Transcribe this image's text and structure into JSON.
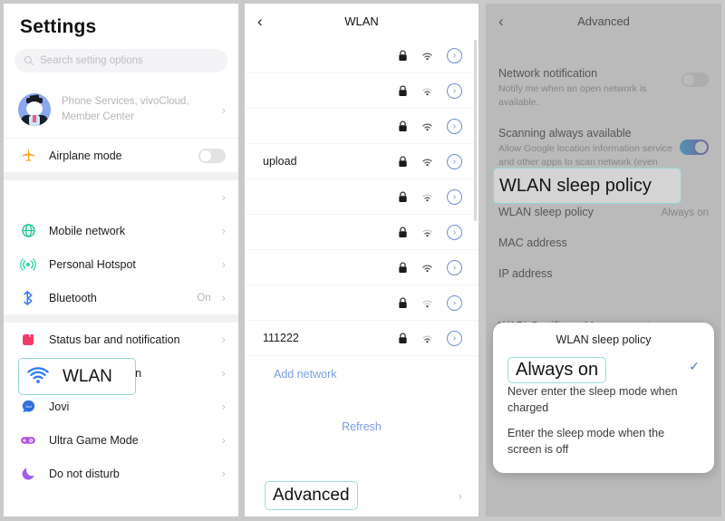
{
  "settings": {
    "title": "Settings",
    "search": {
      "placeholder": "Search setting options",
      "icon": "search-icon"
    },
    "account": {
      "text": "Phone Services, vivoCloud, Member Center",
      "icon": "avatar"
    },
    "groups": [
      {
        "items": [
          {
            "label": "Airplane mode",
            "icon": "airplane-icon",
            "control": "toggle-off",
            "value": ""
          }
        ]
      },
      {
        "items": [
          {
            "label": "WLAN",
            "icon": "wifi-icon",
            "control": "chevron",
            "value": "",
            "highlighted": true
          },
          {
            "label": "Mobile network",
            "icon": "globe-icon",
            "control": "chevron",
            "value": ""
          },
          {
            "label": "Personal Hotspot",
            "icon": "hotspot-icon",
            "control": "chevron",
            "value": ""
          },
          {
            "label": "Bluetooth",
            "icon": "bluetooth-icon",
            "control": "chevron",
            "value": "On"
          }
        ]
      },
      {
        "items": [
          {
            "label": "Status bar and notification",
            "icon": "status-bar-icon",
            "control": "chevron",
            "value": ""
          },
          {
            "label": "System navigation",
            "icon": "system-navigation-icon",
            "control": "chevron",
            "value": ""
          },
          {
            "label": "Jovi",
            "icon": "jovi-icon",
            "control": "chevron",
            "value": ""
          },
          {
            "label": "Ultra Game Mode",
            "icon": "game-mode-icon",
            "control": "chevron",
            "value": ""
          },
          {
            "label": "Do not disturb",
            "icon": "moon-icon",
            "control": "chevron",
            "value": ""
          }
        ]
      }
    ]
  },
  "wlan": {
    "title": "WLAN",
    "back_icon": "back-chevron-icon",
    "networks": [
      {
        "ssid": "",
        "secured": true,
        "signal": 3
      },
      {
        "ssid": "",
        "secured": true,
        "signal": 2
      },
      {
        "ssid": "",
        "secured": true,
        "signal": 3
      },
      {
        "ssid": "upload",
        "secured": true,
        "signal": 3
      },
      {
        "ssid": "",
        "secured": true,
        "signal": 2
      },
      {
        "ssid": "",
        "secured": true,
        "signal": 2
      },
      {
        "ssid": "",
        "secured": true,
        "signal": 3
      },
      {
        "ssid": "",
        "secured": true,
        "signal": 1
      },
      {
        "ssid": "111222",
        "secured": true,
        "signal": 2
      }
    ],
    "add_network": "Add network",
    "refresh": "Refresh",
    "advanced": "Advanced"
  },
  "advanced": {
    "title": "Advanced",
    "back_icon": "back-chevron-icon",
    "items": [
      {
        "title": "Network notification",
        "subtitle": "Notify me when an open network is available.",
        "control": "toggle-off"
      },
      {
        "title": "Scanning always available",
        "subtitle": "Allow Google location information service and other apps to scan network (even when WLAN is turned off).",
        "control": "toggle-on"
      },
      {
        "title": "WLAN sleep policy",
        "subtitle": "",
        "value": "Always on",
        "control": "value",
        "highlighted": true
      },
      {
        "title": "MAC address",
        "subtitle": "",
        "value": "",
        "control": "value"
      },
      {
        "title": "IP address",
        "subtitle": "",
        "value": "",
        "control": "value"
      },
      {
        "title": "WAPI Certificate Management",
        "subtitle": "",
        "value": "",
        "control": "chevron"
      }
    ]
  },
  "dialog": {
    "title": "WLAN sleep policy",
    "options": [
      {
        "label": "Always on",
        "selected": true,
        "highlighted": true
      },
      {
        "label": "Never enter the sleep mode when charged",
        "selected": false
      },
      {
        "label": "Enter the sleep mode when the screen is off",
        "selected": false
      }
    ],
    "check_icon": "check-icon"
  },
  "colors": {
    "accent_blue": "#4a7fe0",
    "highlight_ring": "#8ed6da",
    "toggle_on_start": "#1ba8e0",
    "toggle_on_end": "#6a3fc4",
    "page_bg": "#c9c9c9"
  }
}
